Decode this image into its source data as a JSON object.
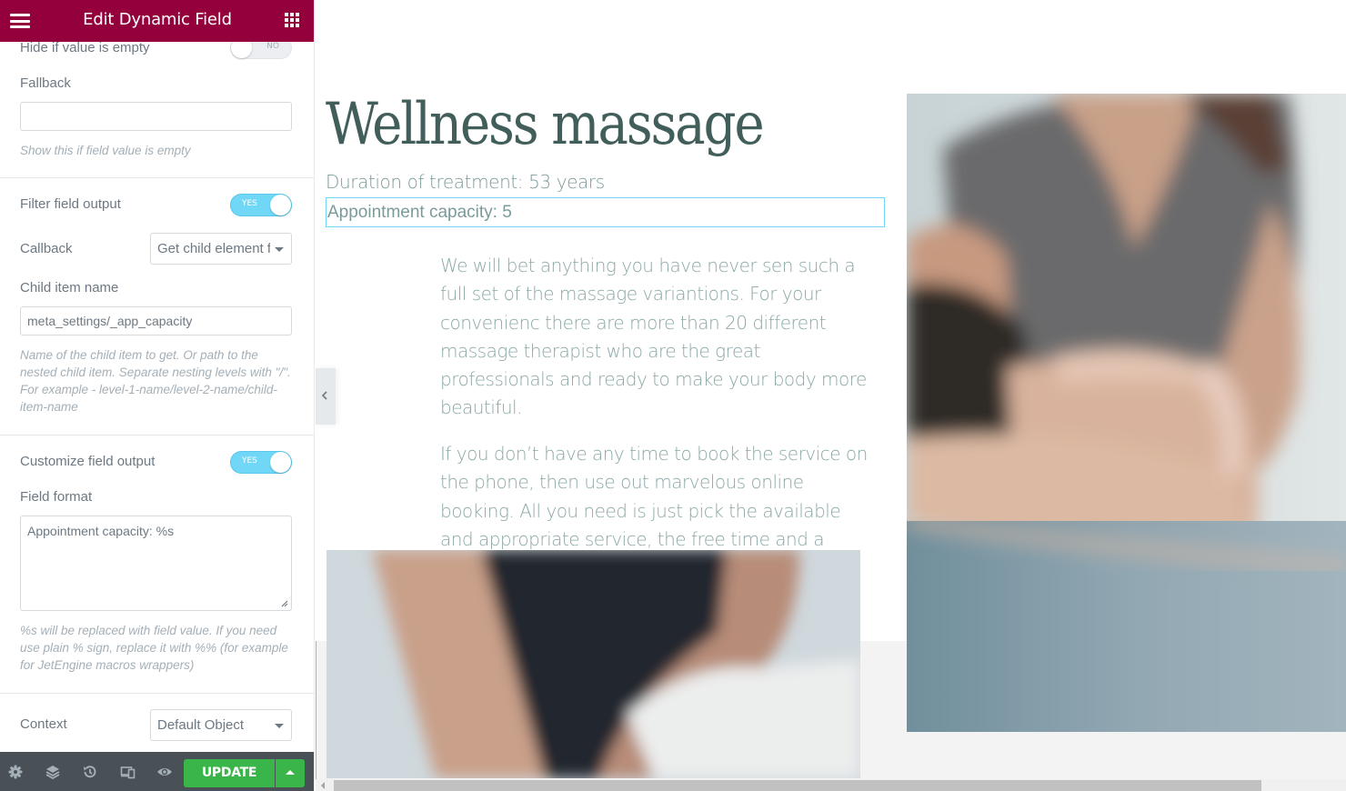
{
  "panel": {
    "header": {
      "title": "Edit Dynamic Field",
      "menu_icon": "hamburger-icon",
      "apps_icon": "grid-apps-icon"
    },
    "controls": {
      "hide_if_empty": {
        "label": "Hide if value is empty",
        "state": "NO"
      },
      "fallback": {
        "label": "Fallback",
        "value": "",
        "description": "Show this if field value is empty"
      },
      "filter_output": {
        "label": "Filter field output",
        "state": "YES"
      },
      "callback": {
        "label": "Callback",
        "value": "Get child element f"
      },
      "child_item": {
        "label": "Child item name",
        "value": "meta_settings/_app_capacity",
        "description": "Name of the child item to get. Or path to the nested child item. Separate nesting levels with \"/\". For example - level-1-name/level-2-name/child-item-name"
      },
      "customize_output": {
        "label": "Customize field output",
        "state": "YES"
      },
      "field_format": {
        "label": "Field format",
        "value": "Appointment capacity: %s",
        "description": "%s will be replaced with field value. If you need use plain % sign, replace it with %% (for example for JetEngine macros wrappers)"
      },
      "context": {
        "label": "Context",
        "value": "Default Object"
      }
    },
    "footer": {
      "icons": [
        "settings-icon",
        "layers-icon",
        "history-icon",
        "responsive-icon",
        "preview-eye-icon"
      ],
      "update_label": "UPDATE"
    }
  },
  "preview": {
    "title": "Wellness massage",
    "duration": "Duration of treatment: 53 years",
    "capacity": "Appointment capacity: 5",
    "paragraph1": "We will bet anything you have never sen such a full set of the massage variantions. For your convenienc there are more than 20 different massage therapist who are the great professionals and ready to make your body more beautiful.",
    "paragraph2": "If you don’t have any time to book the service on the phone, then use out marvelous online booking. All you need is just pick the available and appropriate service, the free time and a",
    "images": [
      "massage-photo-therapist-shoulders",
      "massage-photo-arms-towel"
    ]
  },
  "colors": {
    "header_bg": "#93003c",
    "toggle_on": "#71d7f7",
    "update_green": "#39b54a",
    "heading": "#425e5a",
    "body_text": "#8aa8a6"
  }
}
